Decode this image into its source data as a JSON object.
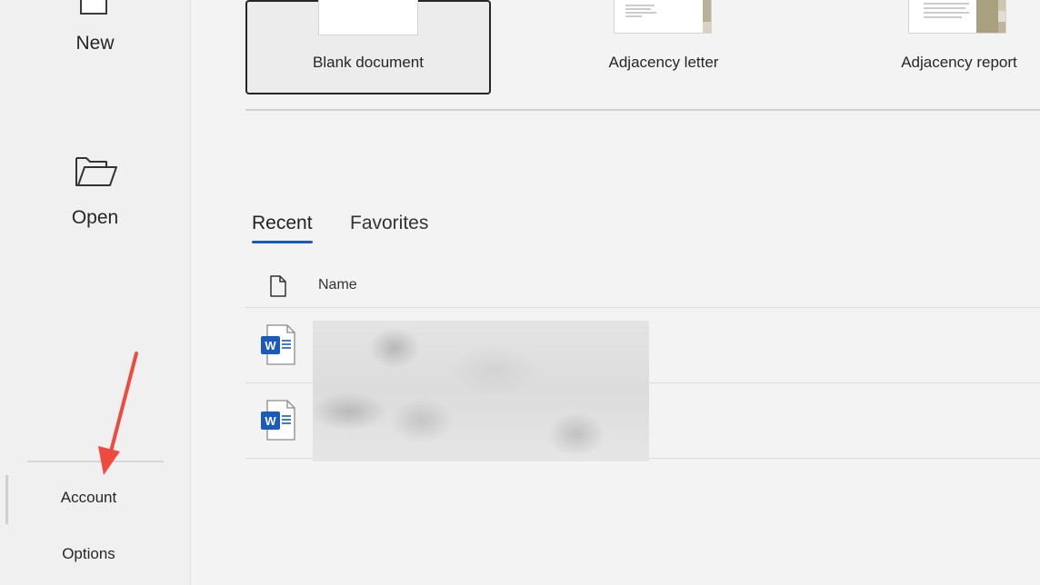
{
  "nav": {
    "new_label": "New",
    "open_label": "Open",
    "account_label": "Account",
    "options_label": "Options"
  },
  "templates": [
    {
      "name": "Blank document"
    },
    {
      "name": "Adjacency letter"
    },
    {
      "name": "Adjacency report"
    }
  ],
  "tabs": {
    "recent": "Recent",
    "favorites": "Favorites"
  },
  "file_list": {
    "name_header": "Name"
  },
  "colors": {
    "accent": "#185abd",
    "annotation_arrow": "#f04a3e",
    "word_blue": "#185abd"
  },
  "icons": {
    "new": "document-icon",
    "open": "folder-icon",
    "file_column": "file-icon",
    "word_file": "word-document-icon"
  }
}
